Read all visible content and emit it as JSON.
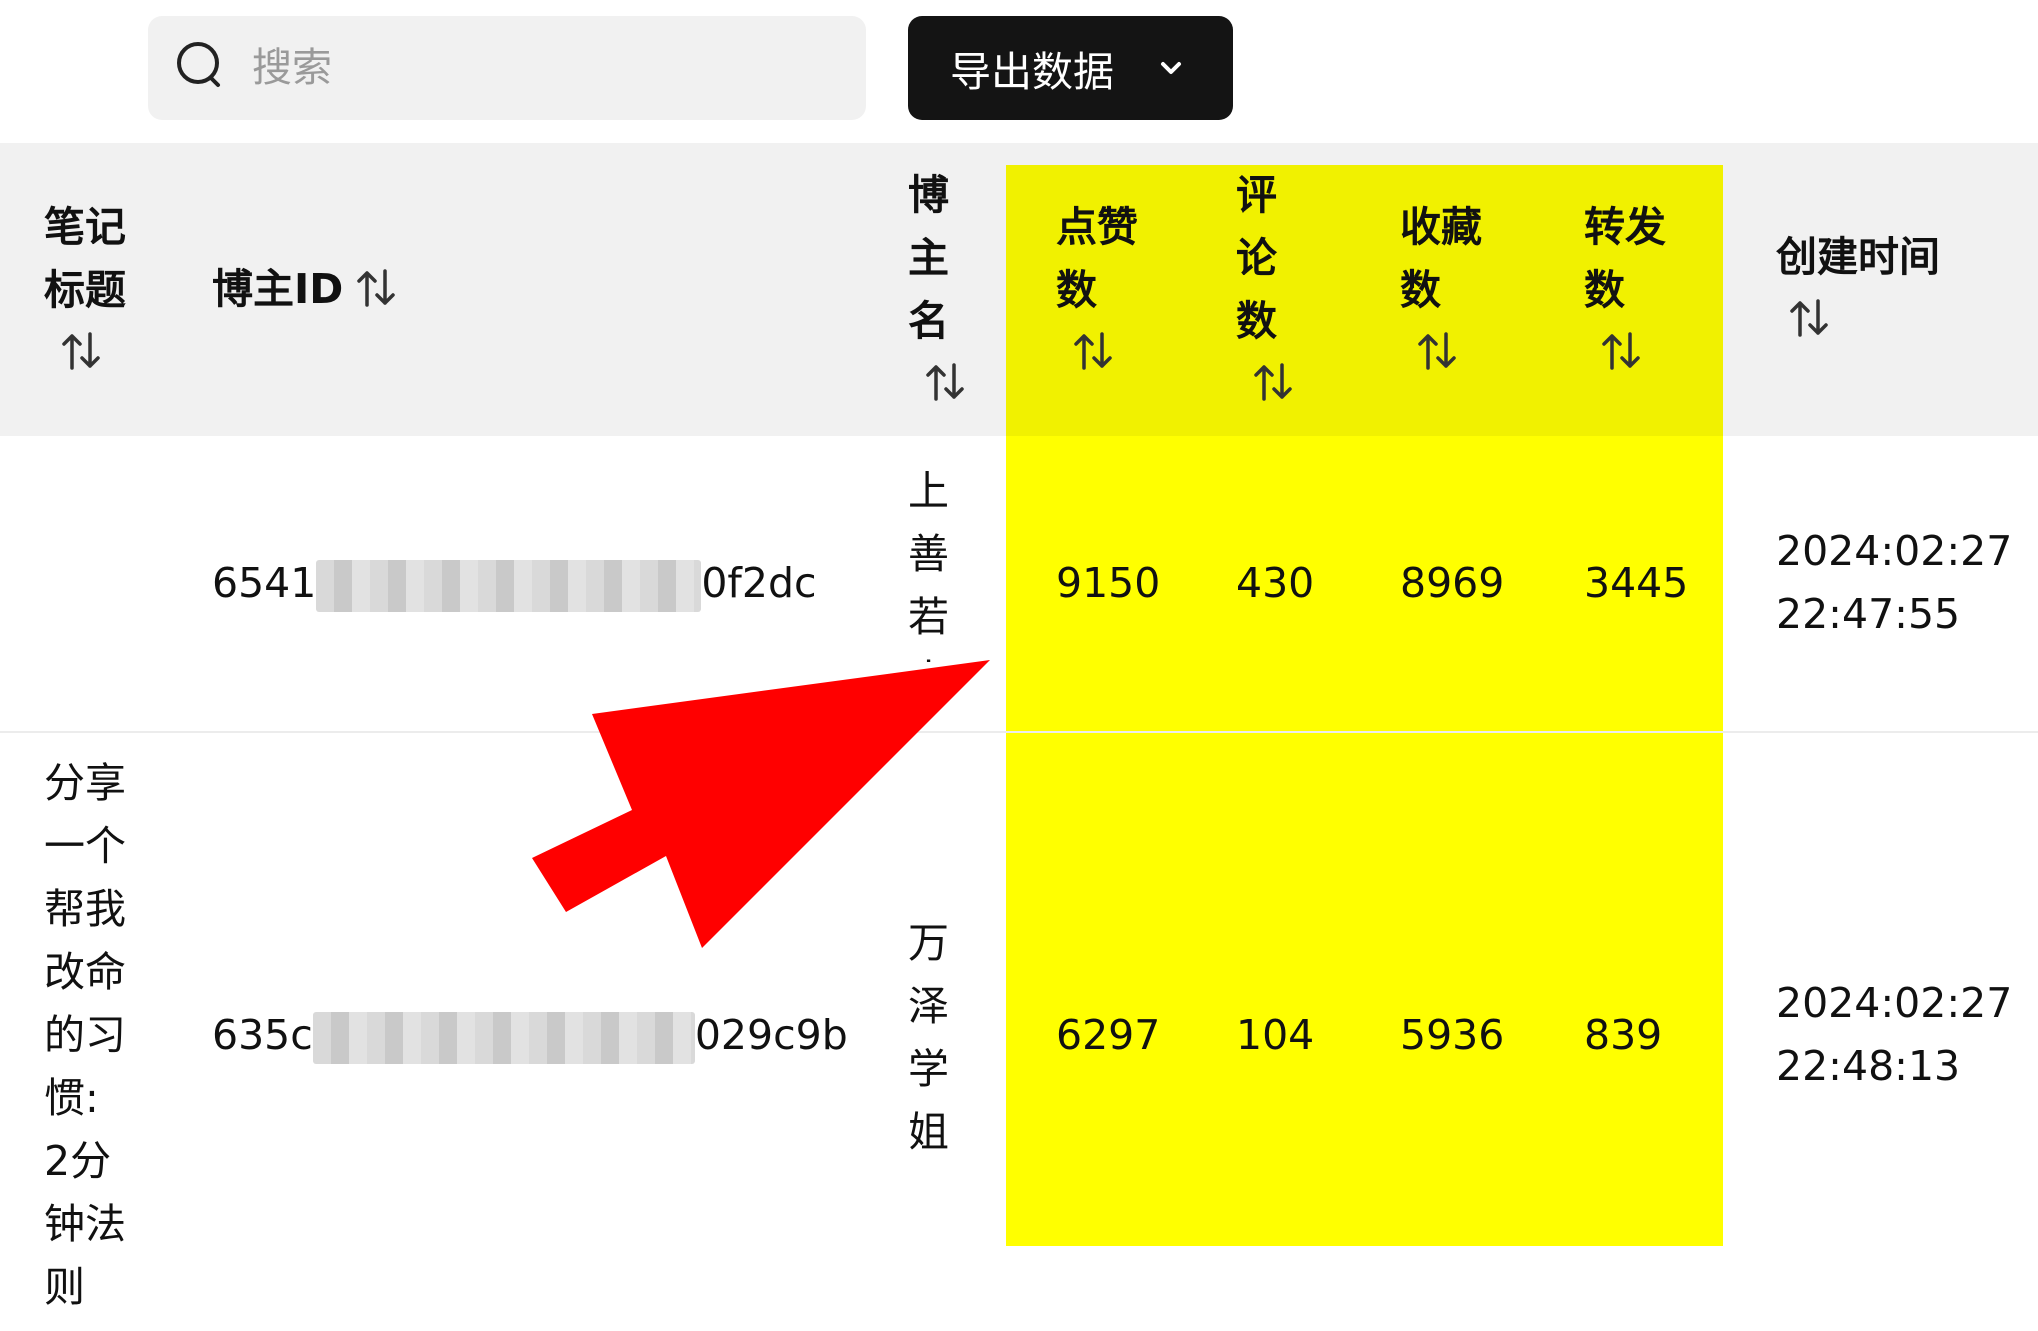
{
  "toolbar": {
    "search_placeholder": "搜索",
    "export_label": "导出数据"
  },
  "columns": {
    "note_title": "笔记标题",
    "blogger_id": "博主ID",
    "blogger_name": "博主名",
    "likes": "点赞数",
    "comments": "评论数",
    "favorites": "收藏数",
    "shares": "转发数",
    "created_time": "创建时间"
  },
  "rows": [
    {
      "note_title": "",
      "blogger_id_prefix": "6541",
      "blogger_id_suffix": "0f2dc",
      "blogger_name": "上善若水",
      "likes": "9150",
      "comments": "430",
      "favorites": "8969",
      "shares": "3445",
      "created_date": "2024:02:27",
      "created_time": "22:47:55"
    },
    {
      "note_title": "分享一个帮我改命的习惯: 2分钟法则",
      "blogger_id_prefix": "635c",
      "blogger_id_suffix": "029c9b",
      "blogger_name": "万泽学姐",
      "likes": "6297",
      "comments": "104",
      "favorites": "5936",
      "shares": "839",
      "created_date": "2024:02:27",
      "created_time": "22:48:13"
    }
  ],
  "highlight_color": "#ffff00",
  "annotation_arrow_color": "#ff0000"
}
